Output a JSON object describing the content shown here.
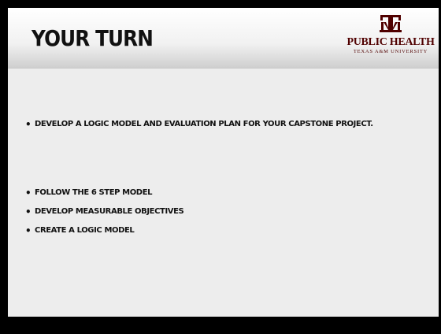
{
  "slide": {
    "title": "YOUR TURN",
    "logo": {
      "name": "PUBLIC HEALTH",
      "sub": "TEXAS A&M UNIVERSITY",
      "brand_color": "#500000"
    },
    "bullets": [
      "DEVELOP A LOGIC MODEL AND EVALUATION PLAN FOR YOUR CAPSTONE PROJECT.",
      "FOLLOW THE 6 STEP MODEL",
      "DEVELOP MEASURABLE OBJECTIVES",
      "CREATE A LOGIC MODEL"
    ],
    "bullet_symbol": "•"
  }
}
